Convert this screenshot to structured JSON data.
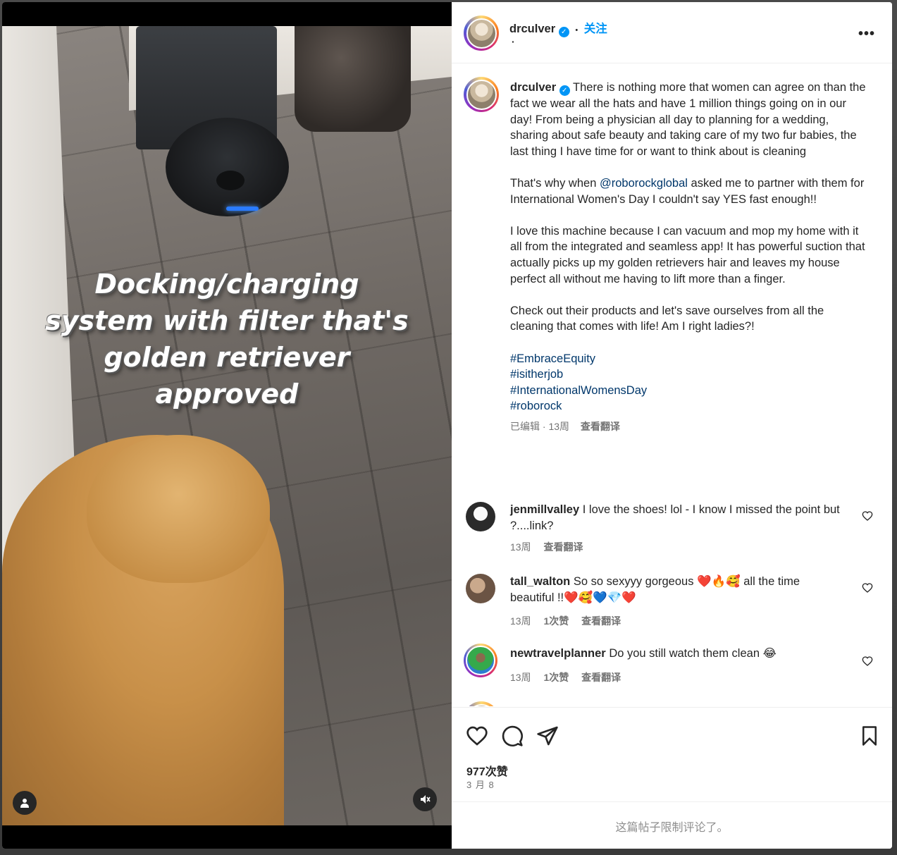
{
  "post": {
    "username": "drculver",
    "follow_label": "关注",
    "header_dot": "•",
    "header_sub": "·",
    "more_label": "•••",
    "video_overlay": [
      "Docking/charging",
      "system with filter that's",
      "golden retriever",
      "approved"
    ],
    "caption": {
      "intro": "There is nothing more that women can agree on than the fact we wear all the hats and have 1 million things going on in our day! From being a physician all day to planning for a wedding, sharing about safe beauty and taking care of my two fur babies, the last thing I have time for or want to think about is cleaning",
      "p2_before": "That's why when ",
      "p2_mention": "@roborockglobal",
      "p2_after": " asked me to partner with them for International Women's Day I couldn't say YES fast enough!!",
      "p3": "I love this machine because I can vacuum and mop my home with it all from the integrated and seamless app! It has powerful suction that actually picks up my golden retrievers hair and leaves my house perfect all without me having to lift more than a finger.",
      "p4": "Check out their products and let's save ourselves from all the cleaning that comes with life! Am I right ladies?!",
      "tags": [
        "#EmbraceEquity",
        "#isitherjob",
        "#InternationalWomensDay",
        "#roborock"
      ],
      "meta_time": "已编辑 · 13周",
      "meta_translate": "查看翻译"
    },
    "comments": [
      {
        "username": "jenmillvalley",
        "text": "I love the shoes! lol - I know I missed the point but ?....link?",
        "time": "13周",
        "likes": "",
        "translate": "查看翻译"
      },
      {
        "username": "tall_walton",
        "text": "So so sexyyy gorgeous ❤️🔥🥰 all the time beautiful !!❤️🥰💙💎❤️",
        "time": "13周",
        "likes": "1次赞",
        "translate": "查看翻译"
      },
      {
        "username": "newtravelplanner",
        "text": "Do you still watch them clean 😂",
        "time": "13周",
        "likes": "1次赞",
        "translate": "查看翻译"
      }
    ],
    "likes_count": "977次赞",
    "date": "3 月 8",
    "comments_disabled": "这篇帖子限制评论了。"
  },
  "icons": {
    "like": "heart-icon",
    "comment": "comment-icon",
    "share": "share-icon",
    "save": "bookmark-icon",
    "mute": "mute-icon",
    "user_tag": "user-tag-icon"
  },
  "colors": {
    "link": "#00376b",
    "follow": "#0095f6",
    "secondary": "#737373"
  }
}
